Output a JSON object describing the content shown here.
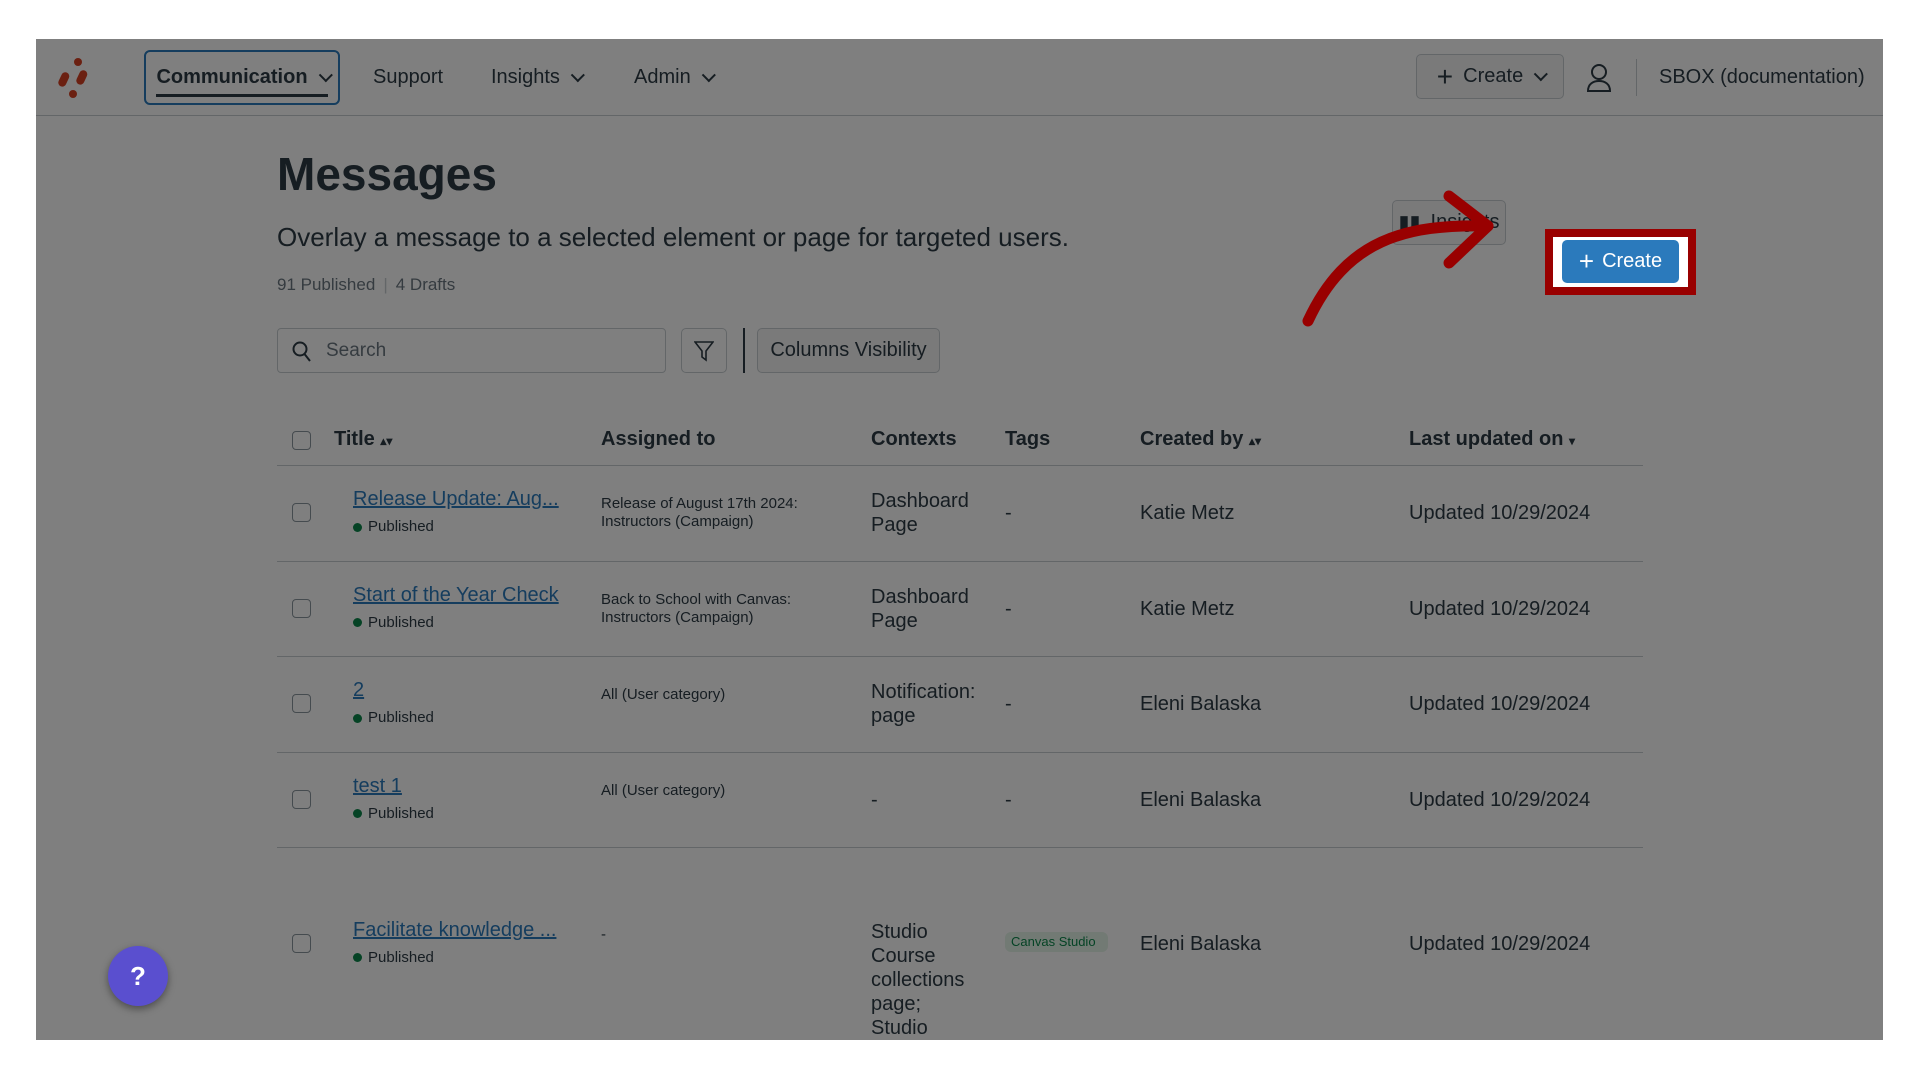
{
  "nav": {
    "items": [
      {
        "label": "Communication",
        "dropdown": true,
        "active": true
      },
      {
        "label": "Support"
      },
      {
        "label": "Insights",
        "dropdown": true
      },
      {
        "label": "Admin",
        "dropdown": true
      }
    ],
    "create_label": "Create",
    "account_label": "SBOX (documentation)"
  },
  "page": {
    "title": "Messages",
    "subtitle": "Overlay a message to a selected element or page for targeted users.",
    "published": "91 Published",
    "drafts": "4 Drafts",
    "insights_label": "Insights",
    "create_label": "Create"
  },
  "toolbar": {
    "search_placeholder": "Search",
    "columns_label": "Columns Visibility"
  },
  "table": {
    "headers": [
      "Title",
      "Assigned to",
      "Contexts",
      "Tags",
      "Created by",
      "Last updated on"
    ],
    "rows": [
      {
        "title": "Release Update: Aug...",
        "status": "Published",
        "assigned": "Release of August 17th 2024: Instructors (Campaign)",
        "contexts": "Dashboard Page",
        "tags": "-",
        "created_by": "Katie Metz",
        "updated": "Updated 10/29/2024"
      },
      {
        "title": "Start of the Year Check",
        "status": "Published",
        "assigned": "Back to School with Canvas: Instructors (Campaign)",
        "contexts": "Dashboard Page",
        "tags": "-",
        "created_by": "Katie Metz",
        "updated": "Updated 10/29/2024"
      },
      {
        "title": "2",
        "status": "Published",
        "assigned": "All (User category)",
        "contexts": "Notification: page",
        "tags": "-",
        "created_by": "Eleni Balaska",
        "updated": "Updated 10/29/2024"
      },
      {
        "title": "test 1",
        "status": "Published",
        "assigned": "All (User category)",
        "contexts": "-",
        "tags": "-",
        "created_by": "Eleni Balaska",
        "updated": "Updated 10/29/2024"
      },
      {
        "title": "Facilitate knowledge ...",
        "status": "Published",
        "assigned": "-",
        "contexts": "Studio Course collections page; Studio Collections page",
        "tags": "Canvas Studio",
        "created_by": "Eleni Balaska",
        "updated": "Updated 10/29/2024"
      }
    ]
  },
  "colors": {
    "accent": "#2b7abc",
    "highlight": "#990000",
    "published": "#0b874b",
    "logo": "#d64123"
  }
}
